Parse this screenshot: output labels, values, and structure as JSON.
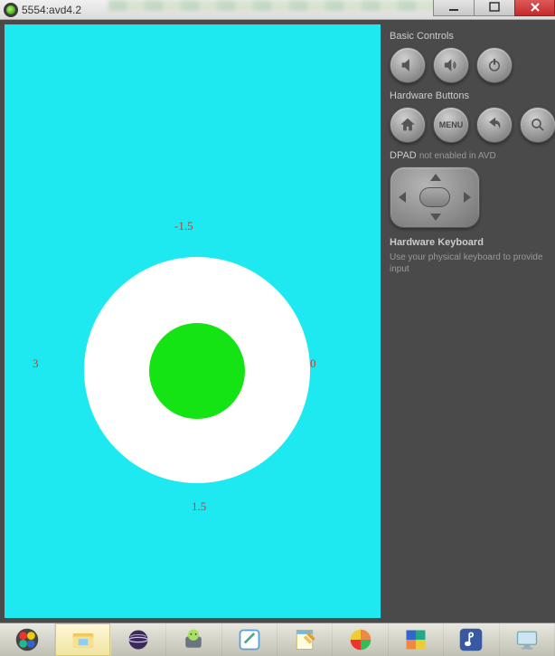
{
  "window": {
    "title": "5554:avd4.2"
  },
  "device": {
    "labels": {
      "top": "-1.5",
      "right": "0",
      "bottom": "1.5",
      "left": "3"
    }
  },
  "panel": {
    "basic_controls": "Basic Controls",
    "hardware_buttons": "Hardware Buttons",
    "menu_label": "MENU",
    "dpad_label": "DPAD",
    "dpad_disabled": "not enabled in AVD",
    "keyboard_title": "Hardware Keyboard",
    "keyboard_hint": "Use your physical keyboard to provide input"
  }
}
